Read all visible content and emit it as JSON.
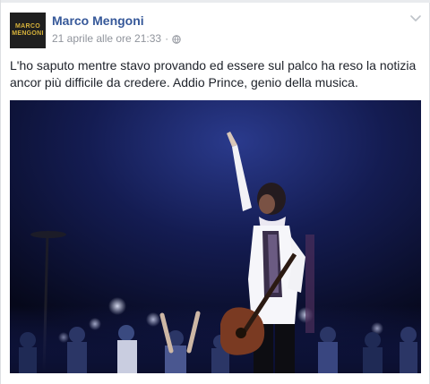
{
  "post": {
    "author": "Marco Mengoni",
    "avatar_text_line1": "MARCO",
    "avatar_text_line2": "MENGONI",
    "timestamp": "21 aprile alle ore 21:33",
    "separator": "·",
    "privacy_icon": "globe-icon",
    "menu_icon": "chevron-down-icon",
    "text": "L'ho saputo mentre stavo provando ed essere sul palco ha reso la notizia ancor più difficile da credere. Addio Prince, genio della musica."
  },
  "colors": {
    "author_link": "#365899",
    "meta_text": "#90949c",
    "body_text": "#1d2129",
    "avatar_bg": "#1f1f1f",
    "avatar_text": "#d7b23a",
    "photo_bg": "#0a0f24"
  }
}
